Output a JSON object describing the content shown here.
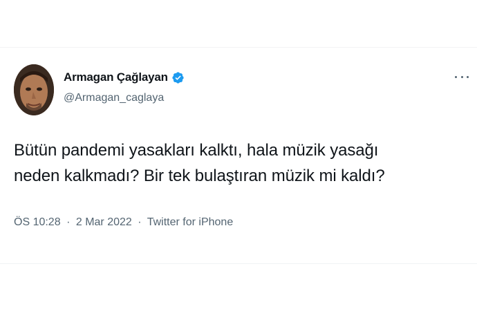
{
  "tweet": {
    "author": {
      "display_name": "Armagan Çağlayan",
      "handle": "@Armagan_caglaya",
      "verified": true,
      "verified_color": "#1d9bf0"
    },
    "text_lines": [
      "Bütün pandemi yasakları kalktı, hala müzik yasağı",
      "neden kalkmadı? Bir tek bulaştıran müzik mi kaldı?"
    ],
    "meta": {
      "time": "ÖS 10:28",
      "separator": "·",
      "date": "2 Mar 2022",
      "source": "Twitter for iPhone"
    },
    "icons": {
      "more": "more-options-icon",
      "verified": "verified-badge-icon"
    }
  }
}
